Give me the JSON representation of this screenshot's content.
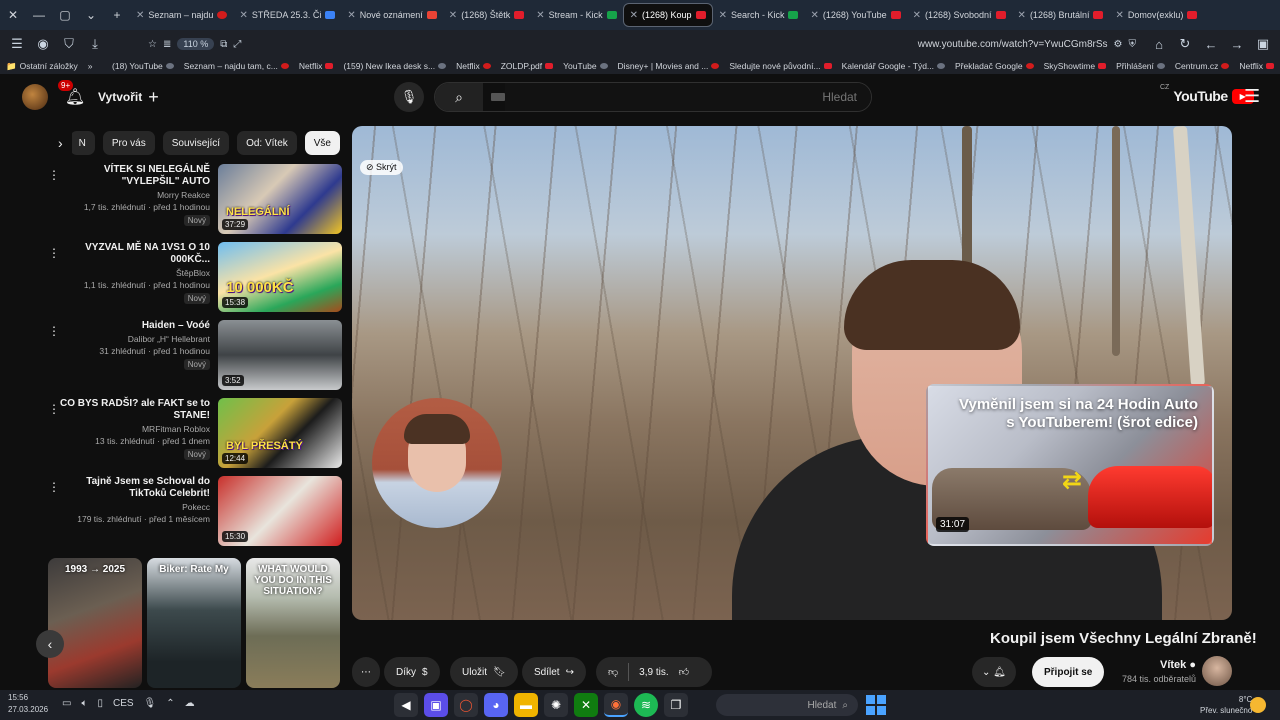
{
  "browser": {
    "tabs": [
      {
        "label": "Seznam – najdu",
        "icon": "seznam"
      },
      {
        "label": "STŘEDA 25.3. Či",
        "icon": "blue"
      },
      {
        "label": "Nové oznámení",
        "icon": "gmail"
      },
      {
        "label": "(1268) Štětk",
        "icon": "youtube"
      },
      {
        "label": "Stream - Kick",
        "icon": "green"
      },
      {
        "label": "(1268) Koup",
        "icon": "youtube",
        "active": true
      },
      {
        "label": "Search - Kick",
        "icon": "green"
      },
      {
        "label": "(1268) YouTube",
        "icon": "youtube"
      },
      {
        "label": "(1268) Svobodní",
        "icon": "youtube"
      },
      {
        "label": "(1268) Brutální",
        "icon": "youtube"
      },
      {
        "label": "Domov(exklu)",
        "icon": "youtube"
      }
    ],
    "url": "www.youtube.com/watch?v=YwuCGm8rSs",
    "zoom": "110 %",
    "bookmarks": [
      "Netflix",
      "Centrum.cz",
      "Přihlášení",
      "SkyShowtime",
      "Překladač Google",
      "Kalendář Google - Týd...",
      "Sledujte nové původní...",
      "Disney+ | Movies and ...",
      "YouTube",
      "ZOLDP.pdf",
      "Netflix",
      "(159) New Ikea desk s...",
      "Netflix",
      "Seznam – najdu tam, c...",
      "(18) YouTube"
    ],
    "bookmarks_more": "Ostatní záložky"
  },
  "header": {
    "notif_count": "9+",
    "create_label": "Vytvořit",
    "search_placeholder": "Hledat",
    "logo_text": "YouTube",
    "logo_region": "CZ"
  },
  "chips": [
    "Vše",
    "Od: Vítek",
    "Související",
    "Pro vás",
    "N"
  ],
  "recommendations": [
    {
      "title": "VÍTEK SI NELEGÁLNĚ \"VYLEPŠIL\" AUTO",
      "channel": "Morry Reakce",
      "stats": "1,7 tis. zhlédnutí · před 1 hodinou",
      "badge": "Nový",
      "duration": "37:29",
      "thumb_text": "NELEGÁLNÍ"
    },
    {
      "title": "VYZVAL MĚ NA 1VS1 O 10 000KČ...",
      "channel": "ŠtěpBlox",
      "stats": "1,1 tis. zhlédnutí · před 1 hodinou",
      "badge": "Nový",
      "duration": "15:38",
      "thumb_text": "10 000KČ"
    },
    {
      "title": "Haiden – Voóé",
      "channel": "Dalibor „H“ Hellebrant",
      "stats": "31 zhlédnutí · před 1 hodinou",
      "badge": "Nový",
      "duration": "3:52",
      "thumb_text": ""
    },
    {
      "title": "CO BYS RADŠI? ale FAKT se to STANE!",
      "channel": "MRFitman Roblox",
      "stats": "13 tis. zhlédnutí · před 1 dnem",
      "badge": "Nový",
      "duration": "12:44",
      "thumb_text": "BYL PŘESÁTÝ"
    },
    {
      "title": "Tajně Jsem se Schoval do TikToků Celebrit!",
      "channel": "Pokecc",
      "stats": "179 tis. zhlédnutí · před 1 měsícem",
      "badge": "",
      "duration": "15:30",
      "thumb_text": ""
    }
  ],
  "shorts": [
    {
      "label": "1993 → 2025"
    },
    {
      "label": "Biker: Rate My"
    },
    {
      "label": "WHAT WOULD YOU DO IN THIS SITUATION?"
    }
  ],
  "player": {
    "hide_label": "Skrýt",
    "endcard_title": "Vyměnil jsem si na 24 Hodin Auto s YouTuberem! (šrot edice)",
    "endcard_duration": "31:07"
  },
  "video": {
    "title": "Koupil jsem Všechny Legální Zbraně!",
    "channel": "Vítek",
    "subscribers": "784 tis. odběratelů",
    "join_label": "Připojit se",
    "likes": "3,9 tis.",
    "share_label": "Sdílet",
    "save_label": "Uložit",
    "thanks_label": "Díky"
  },
  "taskbar": {
    "time": "15:56",
    "date": "27.03.2026",
    "lang": "CES",
    "search_placeholder": "Hledat",
    "weather_temp": "8°C",
    "weather_desc": "Přev. slunečno"
  }
}
